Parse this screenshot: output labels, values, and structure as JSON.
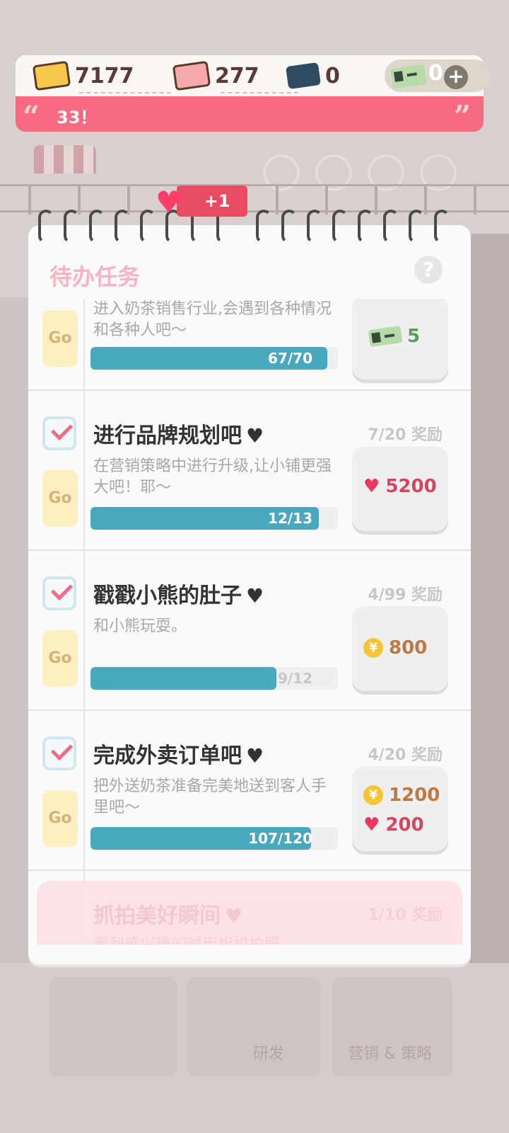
{
  "resources": {
    "gold_cards": "7177",
    "heart_cards": "277",
    "blue_tickets": "0",
    "green_tickets": "0"
  },
  "banner": {
    "text": "33！"
  },
  "heart_popup": {
    "label": "+1"
  },
  "panel": {
    "title": "待办任务",
    "help": "?"
  },
  "tasks": [
    {
      "title": "",
      "desc": "进入奶茶销售行业,会遇到各种情况和各种人吧～",
      "progress_label": "67/70",
      "progress": 0.957,
      "rewards": [
        {
          "kind": "green-ticket",
          "value": "5"
        }
      ]
    },
    {
      "title": "进行品牌规划吧",
      "count": "7/20 奖励",
      "desc": "在营销策略中进行升级,让小铺更强大吧！耶～",
      "progress_label": "12/13",
      "progress": 0.923,
      "rewards": [
        {
          "kind": "heart",
          "value": "5200"
        }
      ]
    },
    {
      "title": "戳戳小熊的肚子",
      "count": "4/99 奖励",
      "desc": "和小熊玩耍。",
      "progress_label": "9/12",
      "progress": 0.75,
      "rewards": [
        {
          "kind": "coin",
          "value": "800"
        }
      ]
    },
    {
      "title": "完成外卖订单吧",
      "count": "4/20 奖励",
      "desc": "把外送奶茶准备完美地送到客人手里吧～",
      "progress_label": "107/120",
      "progress": 0.892,
      "rewards": [
        {
          "kind": "coin",
          "value": "1200"
        },
        {
          "kind": "heart",
          "value": "200"
        }
      ]
    },
    {
      "title": "抓拍美好瞬间",
      "count": "1/10 奖励",
      "desc": "看到感兴趣的时用相机拍照",
      "faded": true
    }
  ],
  "background_tabs": [
    "研发",
    "营销 & 策略"
  ],
  "common": {
    "go_label": "Go",
    "heart_glyph": "♥",
    "coin_glyph": "¥"
  }
}
